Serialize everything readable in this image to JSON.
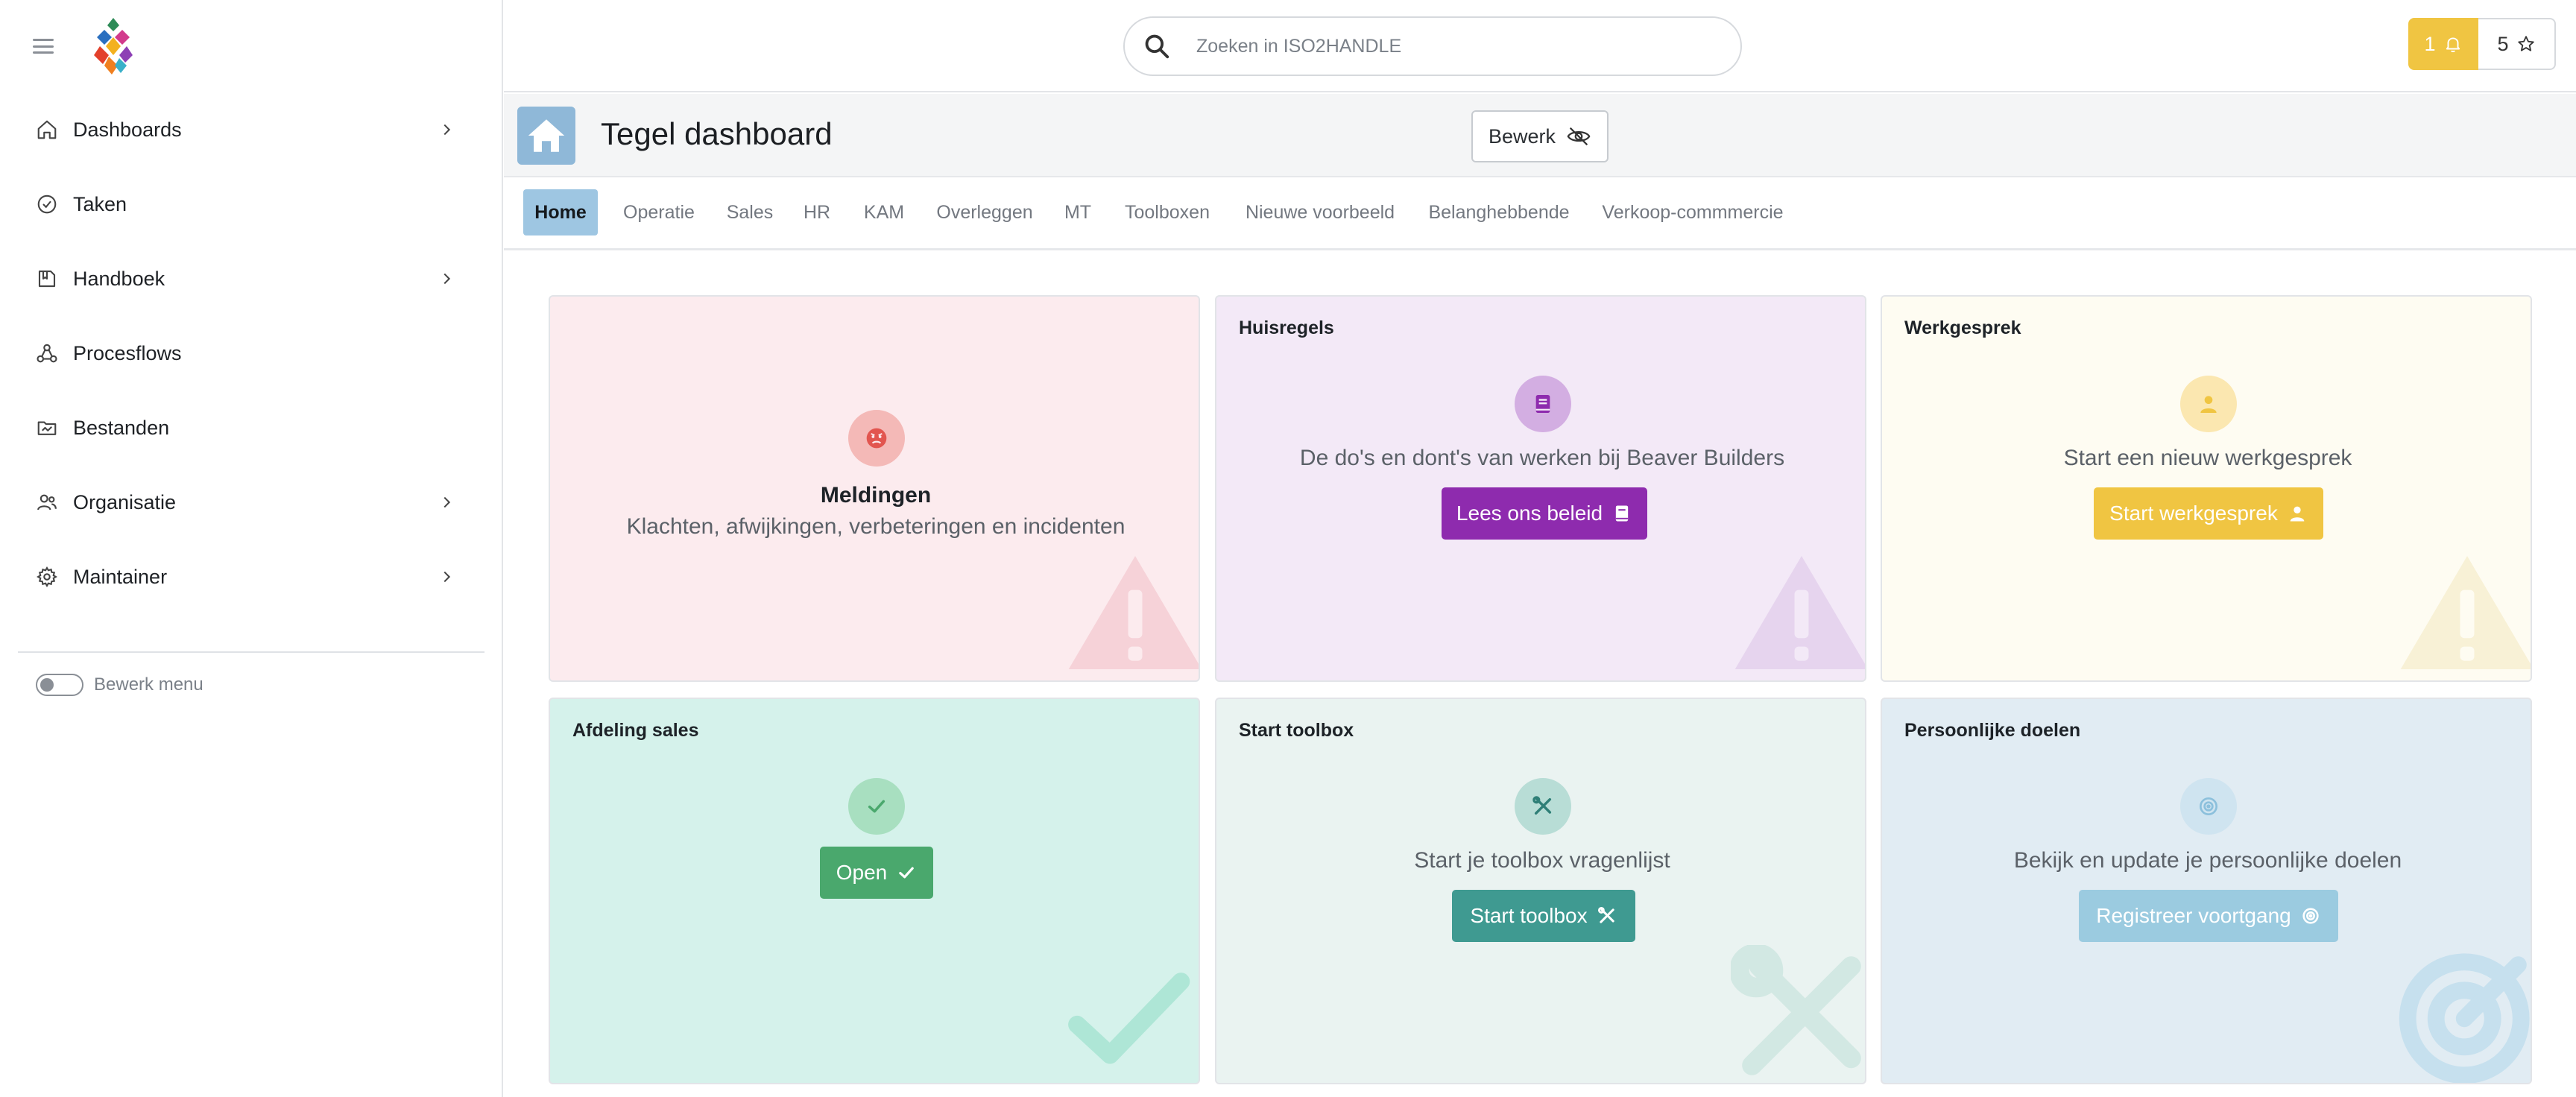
{
  "sidebar": {
    "items": [
      {
        "label": "Dashboards",
        "icon": "home-icon",
        "has_children": true
      },
      {
        "label": "Taken",
        "icon": "check-circle-icon",
        "has_children": false
      },
      {
        "label": "Handboek",
        "icon": "book-icon",
        "has_children": true
      },
      {
        "label": "Procesflows",
        "icon": "process-flow-icon",
        "has_children": false
      },
      {
        "label": "Bestanden",
        "icon": "folder-icon",
        "has_children": false
      },
      {
        "label": "Organisatie",
        "icon": "users-icon",
        "has_children": true
      },
      {
        "label": "Maintainer",
        "icon": "gear-icon",
        "has_children": true
      }
    ],
    "edit_menu_label": "Bewerk menu",
    "edit_menu_enabled": false
  },
  "topbar": {
    "search_placeholder": "Zoeken in ISO2HANDLE",
    "notification_count": "1",
    "favorites_count": "5"
  },
  "page": {
    "title": "Tegel dashboard",
    "edit_button": "Bewerk"
  },
  "tabs": [
    {
      "label": "Home",
      "active": true
    },
    {
      "label": "Operatie"
    },
    {
      "label": "Sales"
    },
    {
      "label": "HR"
    },
    {
      "label": "KAM"
    },
    {
      "label": "Overleggen"
    },
    {
      "label": "MT"
    },
    {
      "label": "Toolboxen"
    },
    {
      "label": "Nieuwe voorbeeld"
    },
    {
      "label": "Belanghebbende"
    },
    {
      "label": "Verkoop-commmercie"
    }
  ],
  "tiles": [
    {
      "title": "",
      "heading": "Meldingen",
      "text": "Klachten, afwijkingen, verbeteringen en incidenten",
      "button": "",
      "color": "#e2554f",
      "bg": "#fcebee",
      "icon": "angry-face-icon",
      "watermark": "warning-triangle-icon"
    },
    {
      "title": "Huisregels",
      "text": "De do's en dont's van werken bij Beaver Builders",
      "button": "Lees ons beleid",
      "color": "#8e2bae",
      "bg": "#f3e9f7",
      "icon": "book-icon",
      "watermark": "warning-triangle-icon"
    },
    {
      "title": "Werkgesprek",
      "text": "Start een nieuw werkgesprek",
      "button": "Start werkgesprek",
      "color": "#f0c542",
      "bg": "#fefcf2",
      "icon": "user-icon",
      "watermark": "warning-triangle-icon"
    },
    {
      "title": "Afdeling sales",
      "text": "",
      "button": "Open",
      "color": "#4aa86d",
      "bg": "#d5f2eb",
      "icon": "check-icon",
      "watermark": "check-icon"
    },
    {
      "title": "Start toolbox",
      "text": "Start je toolbox vragenlijst",
      "button": "Start toolbox",
      "color": "#3f9a91",
      "bg": "#eaf3f1",
      "icon": "tools-icon",
      "watermark": "tools-icon"
    },
    {
      "title": "Persoonlijke doelen",
      "text": "Bekijk en update je persoonlijke doelen",
      "button": "Registreer voortgang",
      "color": "#9bcbe0",
      "bg": "#e1ecf3",
      "icon": "target-icon",
      "watermark": "target-icon"
    }
  ]
}
